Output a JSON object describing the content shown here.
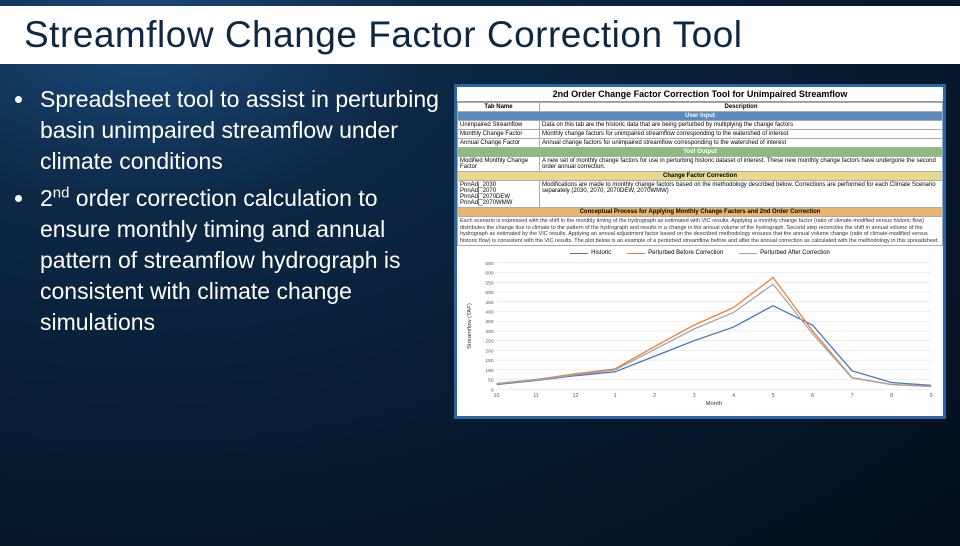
{
  "title": "Streamflow Change Factor Correction Tool",
  "bullets": {
    "b1a": "Spreadsheet tool to assist in perturbing basin unimpaired streamflow under climate conditions",
    "b2a": "2",
    "b2sup": "nd",
    "b2b": " order correction calculation to ensure monthly timing and annual pattern of streamflow hydrograph is consistent with climate change simulations"
  },
  "panel": {
    "heading": "2nd Order Change Factor Correction Tool for Unimpaired Streamflow",
    "col1": "Tab Name",
    "col2": "Description",
    "banner_user": "User Input",
    "row_unimp_a": "Unimpaired Streamflow",
    "row_unimp_b": "Data on this tab are the historic data that are being perturbed by multiplying the change factors",
    "row_mcf_a": "Monthly Change Factor",
    "row_mcf_b": "Monthly change factors for unimpaired streamflow corresponding to the watershed of interest",
    "row_acf_a": "Annual Change Factor",
    "row_acf_b": "Annual change factors for unimpaired streamflow corresponding to the watershed of interest",
    "banner_tool": "Tool Output",
    "row_mod_a": "Modified Monthly Change Factor",
    "row_mod_b": "A new set of monthly change factors for use in perturbing historic dataset of interest. These new monthly change factors have undergone the second order annual correction.",
    "banner_cfc": "Change Factor Correction",
    "row_sc1": "PnnAdj_2030",
    "row_sc2": "PnnAdj_2070",
    "row_sc3": "PnnAdj_2070DEW",
    "row_sc4": "PnnAdj_2070WMW",
    "row_sc_b": "Modifications are made to monthly change factors based on the methodology described below. Corrections are performed for each Climate Scenario separately (2030, 2070, 2070DEW, 2070WMW)",
    "banner_proc": "Conceptual Process for Applying Monthly Change Factors and 2nd Order Correction",
    "paragraph": "Each scenario is expressed with the shift in the monthly timing of the hydrograph as estimated with VIC results. Applying a monthly change factor (ratio of climate-modified versus historic flow) distributes the change due to climate to the pattern of the hydrograph and results in a change in the annual volume of the hydrograph. Second step reconciles the shift in annual volume of the hydrograph as estimated by the VIC results. Applying an annual adjustment factor based on the described methodology ensures that the annual volume change (ratio of climate-modified versus historic flow) is consistent with the VIC results. The plot below is an example of a perturbed streamflow before and after the annual correction as calculated with the methodology in this spreadsheet."
  },
  "chart_data": {
    "type": "line",
    "xlabel": "Month",
    "ylabel": "Streamflow (TAF)",
    "categories": [
      "10",
      "11",
      "12",
      "1",
      "2",
      "3",
      "4",
      "5",
      "6",
      "7",
      "8",
      "9"
    ],
    "ylim": [
      0,
      650
    ],
    "yticks": [
      0,
      50,
      100,
      150,
      200,
      250,
      300,
      350,
      400,
      450,
      500,
      550,
      600,
      650
    ],
    "legend_pos": "top",
    "series": [
      {
        "name": "Historic",
        "color": "#4472c4",
        "values": [
          25,
          45,
          70,
          90,
          170,
          250,
          320,
          430,
          330,
          95,
          35,
          20
        ]
      },
      {
        "name": "Perturbed Before Correction",
        "color": "#ed7d31",
        "values": [
          30,
          50,
          80,
          105,
          220,
          330,
          420,
          575,
          300,
          60,
          25,
          15
        ]
      },
      {
        "name": "Perturbed After Correction",
        "color": "#a5a5a5",
        "values": [
          28,
          48,
          75,
          100,
          205,
          310,
          395,
          540,
          285,
          58,
          24,
          14
        ]
      }
    ]
  }
}
